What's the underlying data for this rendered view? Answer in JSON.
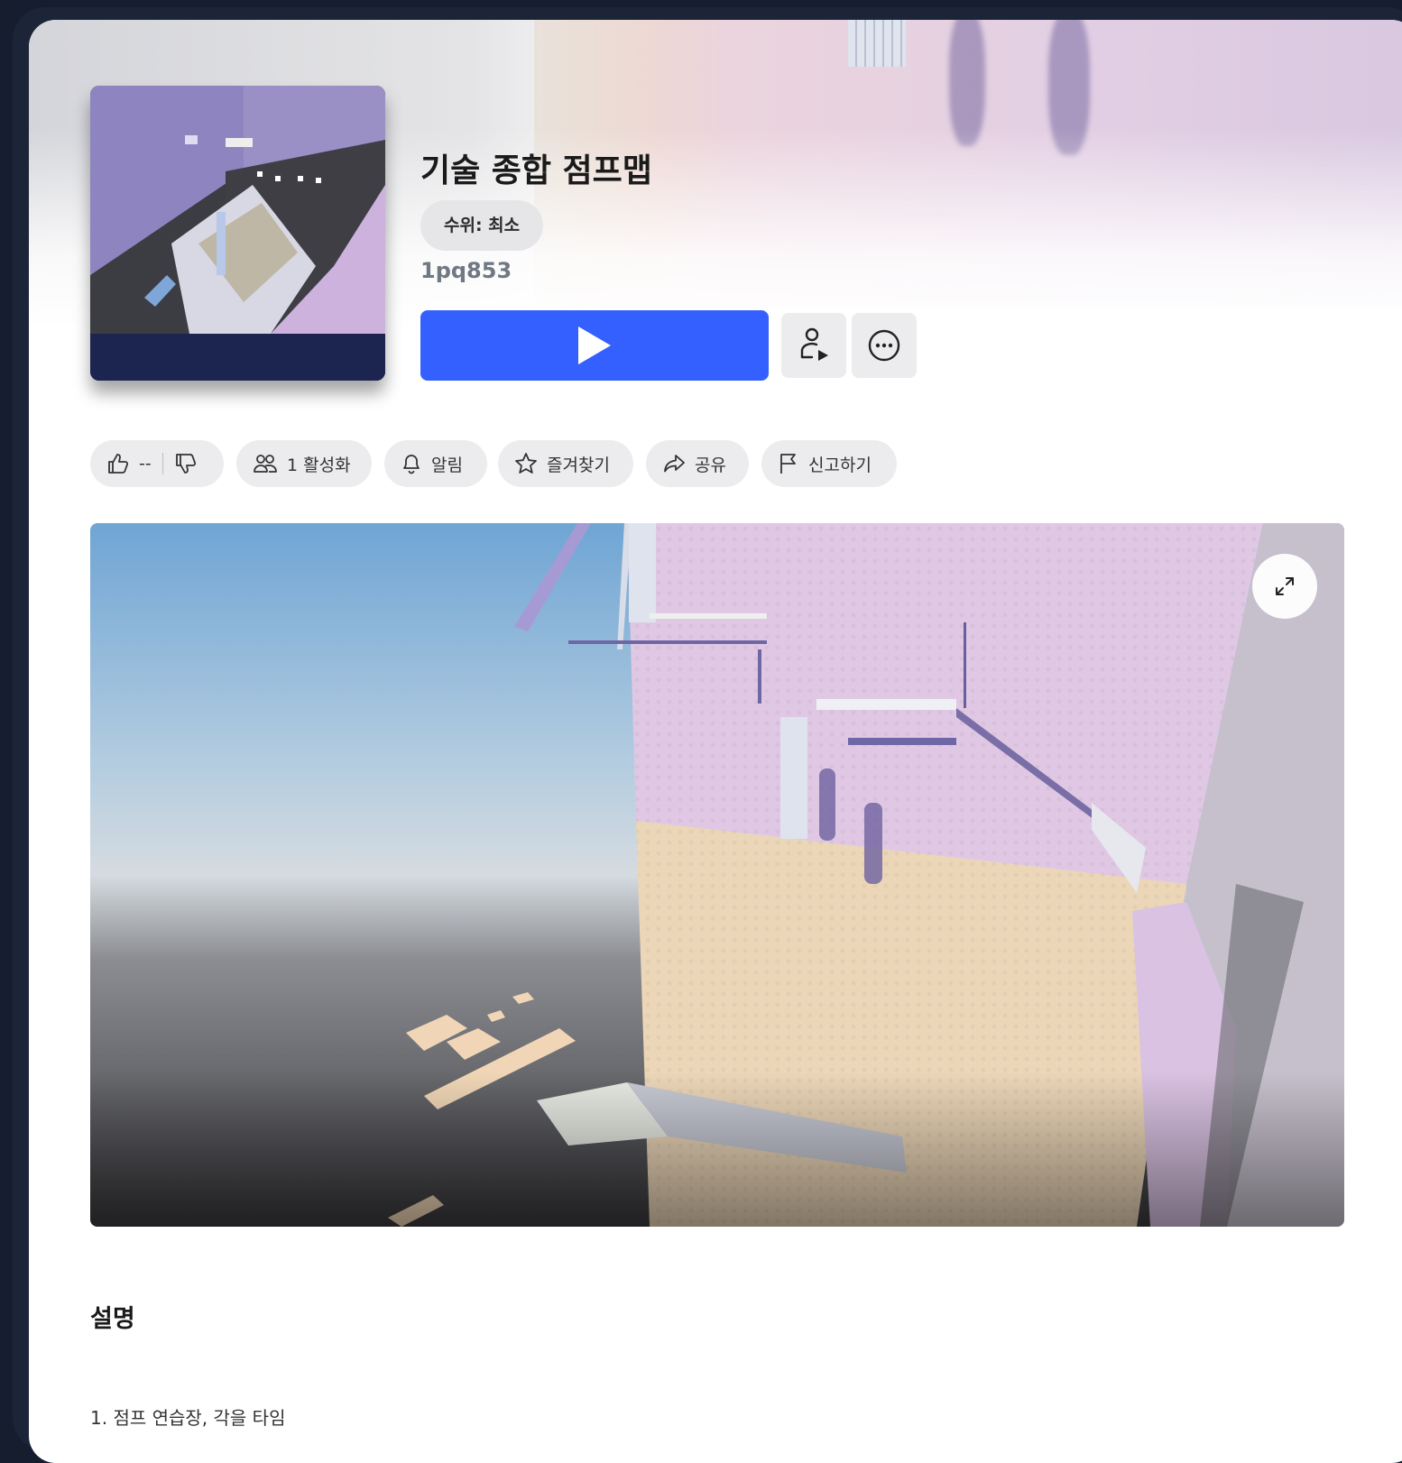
{
  "game": {
    "title": "기술 종합 점프맵",
    "maturity_label": "수위: 최소",
    "creator": "1pq853"
  },
  "actions": {
    "play_icon": "play-icon",
    "party_icon": "person-play-icon",
    "more_icon": "more-horizontal-icon"
  },
  "chips": {
    "vote_count": "--",
    "active": "1 활성화",
    "notify": "알림",
    "favorite": "즐겨찾기",
    "share": "공유",
    "report": "신고하기"
  },
  "media": {
    "expand_icon": "expand-icon"
  },
  "description": {
    "heading": "설명",
    "first_line": "1. 점프 연습장, 각을 타임"
  },
  "colors": {
    "accent": "#3360ff",
    "chip_bg": "#ececee",
    "frame": "#161d2f"
  }
}
